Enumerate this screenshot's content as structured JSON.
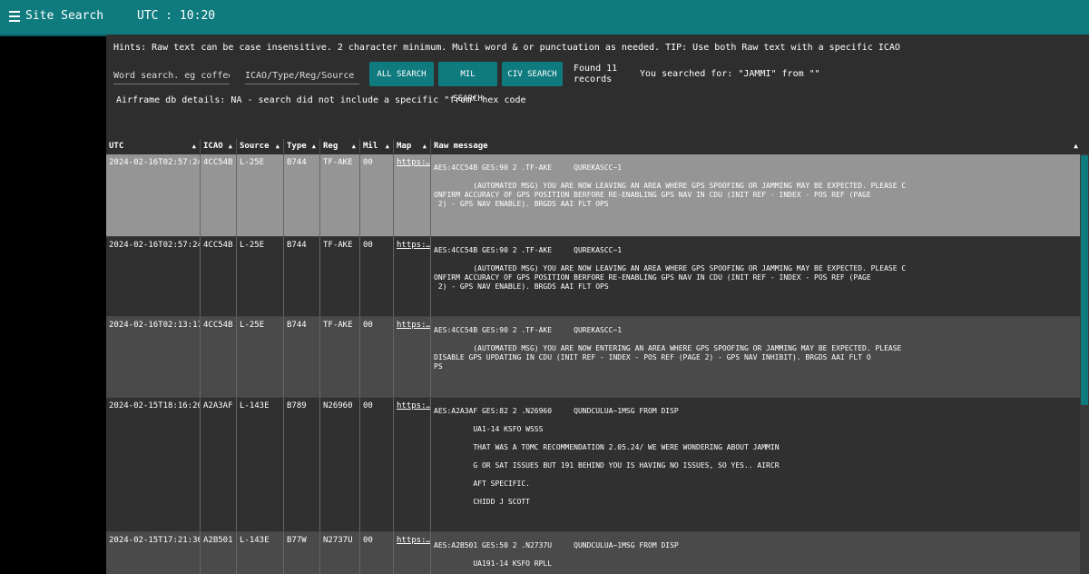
{
  "header": {
    "title": "Site Search",
    "utc": "UTC : 10:20"
  },
  "hints": "Hints: Raw text can be case insensitive. 2 character minimum. Multi word & or punctuation as needed. TIP: Use both Raw text with a specific ICAO",
  "search": {
    "word_placeholder": "Word search. eg coffee",
    "icao_placeholder": "ICAO/Type/Reg/Source",
    "all_label": "ALL SEARCH",
    "mil_label": "MIL SEARCH",
    "civ_label": "CIV SEARCH",
    "found": "Found 11 records",
    "searched": "You searched for: \"JAMMI\" from \"\""
  },
  "airframe": "Airframe db details: NA - search did not include a specific \"from\" hex code",
  "columns": {
    "utc": "UTC",
    "icao": "ICAO",
    "source": "Source",
    "type": "Type",
    "reg": "Reg",
    "mil": "Mil",
    "map": "Map",
    "raw": "Raw message"
  },
  "rows": [
    {
      "utc": "2024-02-16T02:57:24…",
      "icao": "4CC54B",
      "source": "L-25E",
      "type": "B744",
      "reg": "TF-AKE",
      "mil": "00",
      "map": "https:…",
      "msg": "AES:4CC54B GES:90 2 .TF-AKE     QUREKASCC~1\n\n         (AUTOMATED MSG) YOU ARE NOW LEAVING AN AREA WHERE GPS SPOOFING OR JAMMING MAY BE EXPECTED. PLEASE C\nONFIRM ACCURACY OF GPS POSITION BERFORE RE-ENABLING GPS NAV IN CDU (INIT REF - INDEX - POS REF (PAGE\n 2) - GPS NAV ENABLE). BRGDS AAI FLT OPS"
    },
    {
      "utc": "2024-02-16T02:57:24…",
      "icao": "4CC54B",
      "source": "L-25E",
      "type": "B744",
      "reg": "TF-AKE",
      "mil": "00",
      "map": "https:…",
      "msg": "AES:4CC54B GES:90 2 .TF-AKE     QUREKASCC~1\n\n         (AUTOMATED MSG) YOU ARE NOW LEAVING AN AREA WHERE GPS SPOOFING OR JAMMING MAY BE EXPECTED. PLEASE C\nONFIRM ACCURACY OF GPS POSITION BERFORE RE-ENABLING GPS NAV IN CDU (INIT REF - INDEX - POS REF (PAGE\n 2) - GPS NAV ENABLE). BRGDS AAI FLT OPS"
    },
    {
      "utc": "2024-02-16T02:13:17…",
      "icao": "4CC54B",
      "source": "L-25E",
      "type": "B744",
      "reg": "TF-AKE",
      "mil": "00",
      "map": "https:…",
      "msg": "AES:4CC54B GES:90 2 .TF-AKE     QUREKASCC~1\n\n         (AUTOMATED MSG) YOU ARE NOW ENTERING AN AREA WHERE GPS SPOOFING OR JAMMING MAY BE EXPECTED. PLEASE\nDISABLE GPS UPDATING IN CDU (INIT REF - INDEX - POS REF (PAGE 2) - GPS NAV INHIBIT). BRGDS AAI FLT O\nPS"
    },
    {
      "utc": "2024-02-15T18:16:20…",
      "icao": "A2A3AF",
      "source": "L-143E",
      "type": "B789",
      "reg": "N26960",
      "mil": "00",
      "map": "https:…",
      "msg": "AES:A2A3AF GES:82 2 .N26960     QUNDCULUA~1MSG FROM DISP\n\n         UA1-14 KSFO WSSS\n\n         THAT WAS A TOMC RECOMMENDATION 2.05.24/ WE WERE WONDERING ABOUT JAMMIN\n\n         G OR SAT ISSUES BUT 191 BEHIND YOU IS HAVING NO ISSUES, SO YES.. AIRCR\n\n         AFT SPECIFIC.\n\n         CHIDD J SCOTT"
    },
    {
      "utc": "2024-02-15T17:21:36…",
      "icao": "A2B501",
      "source": "L-143E",
      "type": "B77W",
      "reg": "N2737U",
      "mil": "00",
      "map": "https:…",
      "msg": "AES:A2B501 GES:50 2 .N2737U     QUNDCULUA~1MSG FROM DISP\n\n         UA191-14 KSFO RPLL"
    }
  ],
  "colors": {
    "accent": "#0f7b7f",
    "highlight_row": "#959595"
  }
}
